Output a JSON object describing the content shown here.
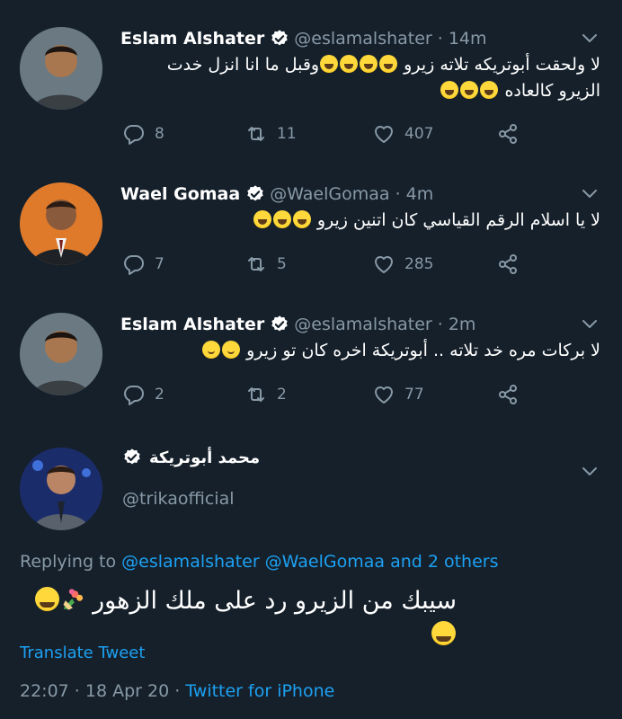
{
  "tweets": [
    {
      "name": "Eslam Alshater",
      "handle": "@eslamalshater · 14m",
      "line1": "لا ولحقت أبوتريكه تلاته زيرو",
      "line1b": "وقبل ما انا انزل خدت",
      "line2": "الزيرو  كالعاده",
      "replies": "8",
      "retweets": "11",
      "likes": "407"
    },
    {
      "name": "Wael Gomaa",
      "handle": "@WaelGomaa · 4m",
      "line1": "لا يا اسلام الرقم القياسي كان اتنين زيرو",
      "replies": "7",
      "retweets": "5",
      "likes": "285"
    },
    {
      "name": "Eslam Alshater",
      "handle": "@eslamalshater · 2m",
      "line1": "لا بركات مره خد تلاته ..  أبوتريكة اخره كان تو زيرو",
      "replies": "2",
      "retweets": "2",
      "likes": "77"
    }
  ],
  "main": {
    "name": "محمد أبوتريكة",
    "handle": "@trikaofficial",
    "replying_prefix": "Replying to",
    "replying_users": "@eslamalshater @WaelGomaa",
    "replying_and": "and 2 others",
    "text": "سيبك من الزيرو رد على ملك الزهور",
    "translate": "Translate Tweet",
    "time": "22:07 · 18 Apr 20 ·",
    "source": "Twitter for iPhone"
  },
  "icons": {
    "reply": "reply-icon",
    "retweet": "retweet-icon",
    "like": "heart-icon",
    "share": "share-icon",
    "verified": "verified-badge-icon",
    "more": "chevron-down-icon"
  },
  "colors": {
    "background": "#15202b",
    "muted": "#8899a6",
    "link": "#1da1f2"
  }
}
